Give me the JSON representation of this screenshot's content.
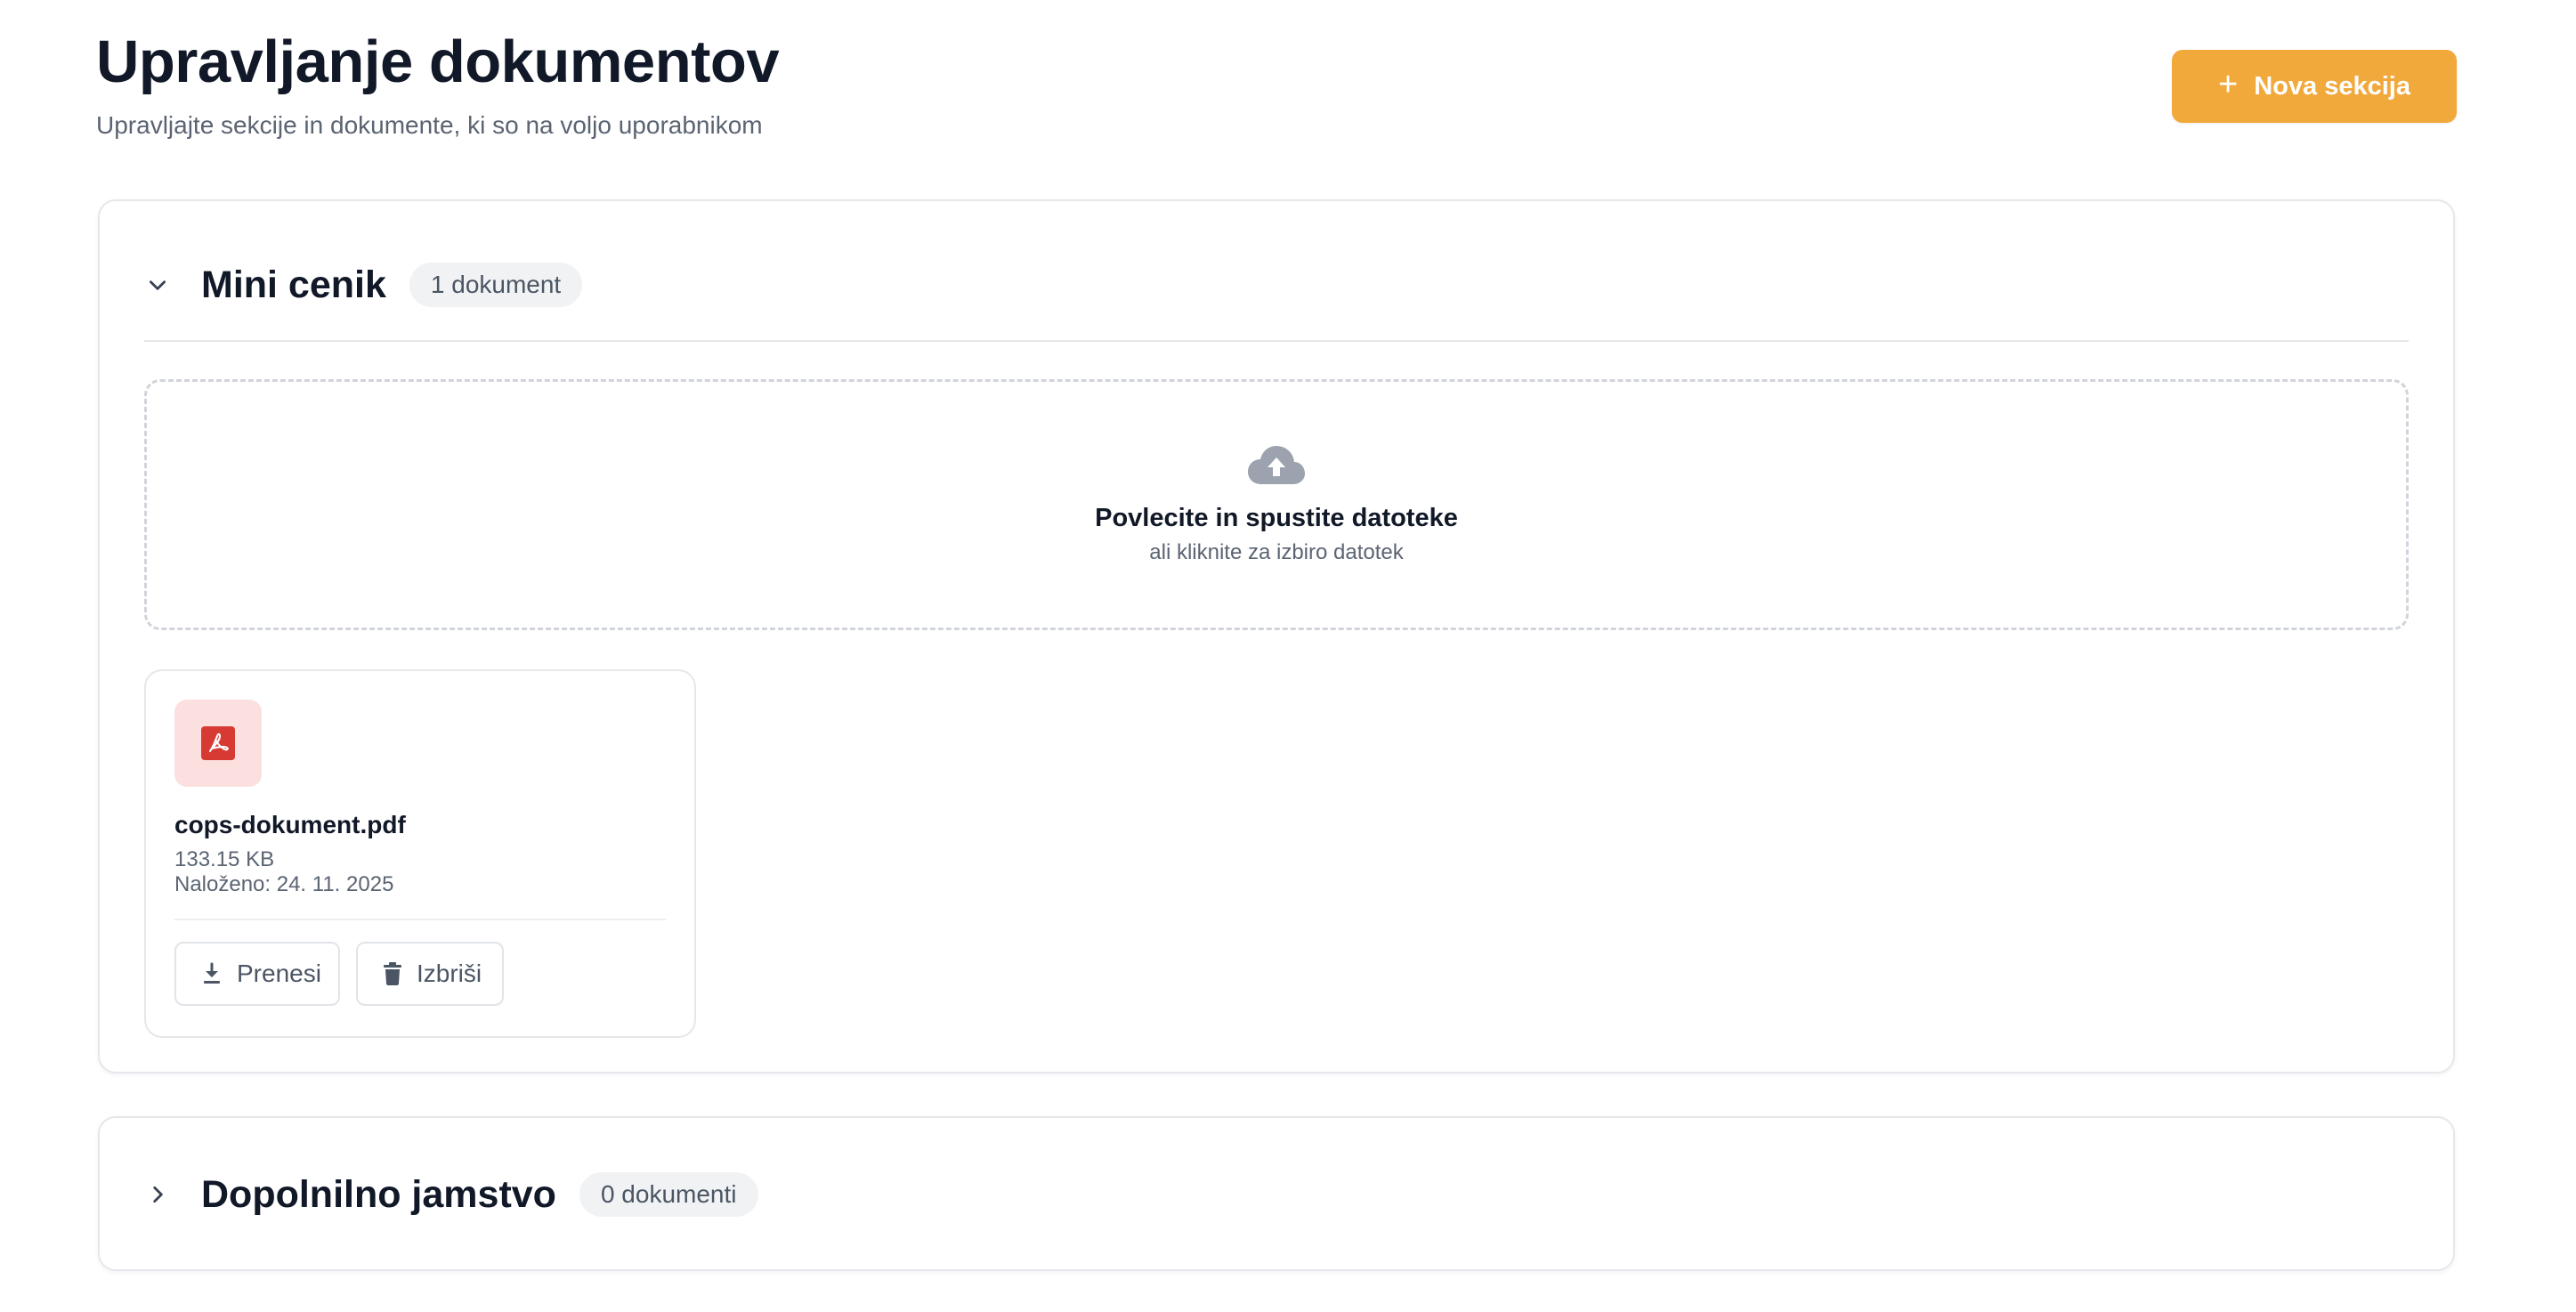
{
  "header": {
    "title": "Upravljanje dokumentov",
    "subtitle": "Upravljajte sekcije in dokumente, ki so na voljo uporabnikom",
    "new_section_label": "Nova sekcija"
  },
  "sections": [
    {
      "name": "Mini cenik",
      "count_label": "1 dokument",
      "expanded": true,
      "dropzone": {
        "title": "Povlecite in spustite datoteke",
        "subtitle": "ali kliknite za izbiro datotek"
      },
      "documents": [
        {
          "file_name": "cops-dokument.pdf",
          "size": "133.15 KB",
          "uploaded": "Naloženo: 24. 11. 2025",
          "icon": "pdf-icon",
          "download_label": "Prenesi",
          "delete_label": "Izbriši"
        }
      ]
    },
    {
      "name": "Dopolnilno jamstvo",
      "count_label": "0 dokumenti",
      "expanded": false
    }
  ],
  "icons": {
    "new_section": "plus-icon",
    "expanded_toggle": "chevron-down-icon",
    "collapsed_toggle": "chevron-right-icon",
    "dropzone": "cloud-upload-icon",
    "download": "download-icon",
    "delete": "trash-icon"
  },
  "colors": {
    "accent": "#f2a93b",
    "pdf_icon_bg": "#fbe0df",
    "pdf_icon": "#d63a33",
    "muted_text": "#5b6472"
  }
}
